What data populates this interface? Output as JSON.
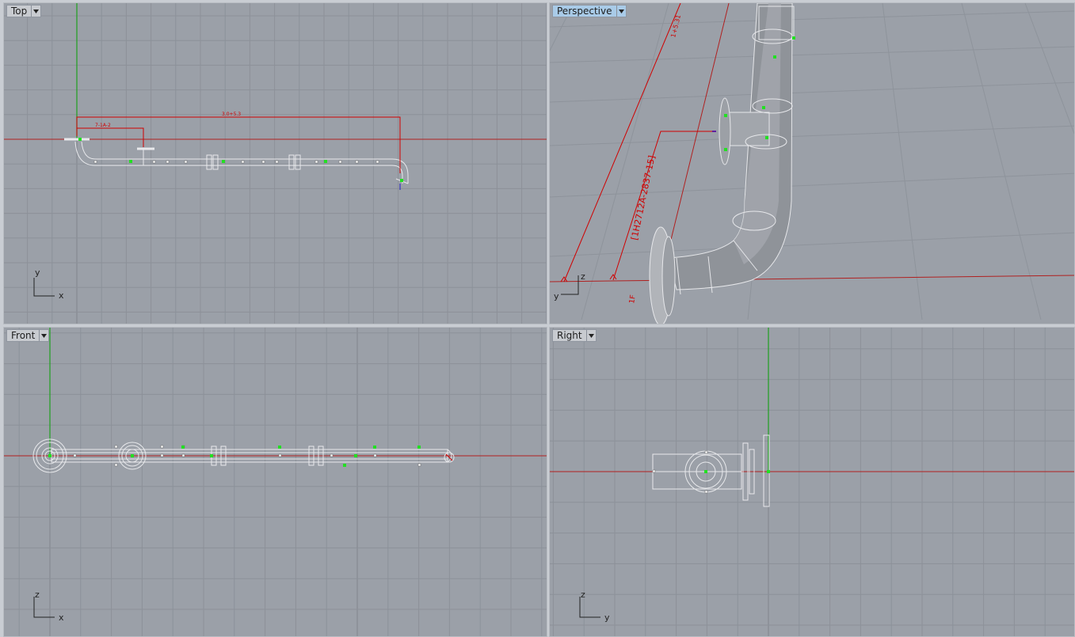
{
  "viewports": {
    "top": {
      "label": "Top",
      "axes": {
        "v": "y",
        "h": "x"
      },
      "dims": {
        "long": "3.0+5.3",
        "short": "7-1A-2"
      }
    },
    "perspective": {
      "label": "Perspective",
      "axes": {
        "v": "z",
        "h": "y"
      },
      "dims": {
        "main": "[1H2712A-2837-15]",
        "upper": "1+5.31",
        "lower": "1F"
      }
    },
    "front": {
      "label": "Front",
      "axes": {
        "v": "z",
        "h": "x"
      }
    },
    "right": {
      "label": "Right",
      "axes": {
        "v": "z",
        "h": "y"
      }
    }
  },
  "colors": {
    "grid_bg": "#9ba0a8",
    "grid_line": "#8d929a",
    "axis_x": "#b02020",
    "axis_y": "#1fa01f",
    "wire": "#e6e7ea",
    "dim": "#d00000",
    "ctrl": "#22e022"
  }
}
